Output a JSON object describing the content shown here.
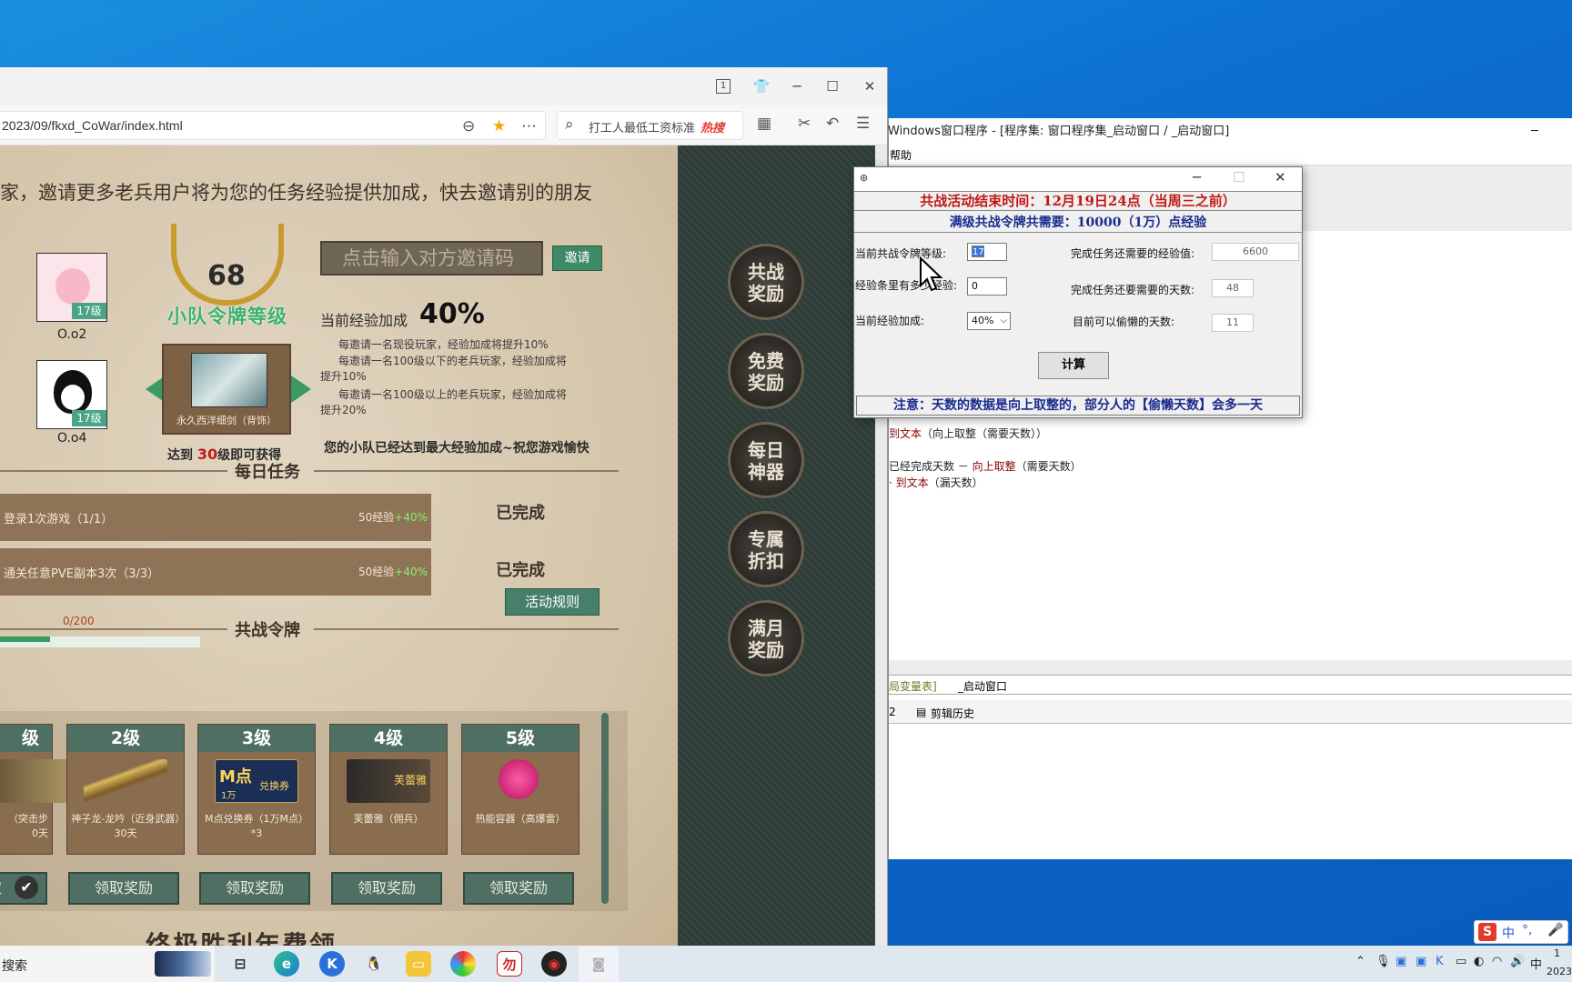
{
  "browser": {
    "url": "2023/09/fkxd_CoWar/index.html",
    "search_text": "打工人最低工资标准",
    "search_hot": "热搜",
    "tab_count": "1"
  },
  "game": {
    "invite_banner": "家，邀请更多老兵用户将为您的任务经验提供加成，快去邀请别的朋友",
    "friends": [
      {
        "name": "O.o2",
        "level": "17级"
      },
      {
        "name": "O.o4",
        "level": "17级"
      }
    ],
    "team_level_num": "68",
    "team_level_title": "小队令牌等级",
    "code_placeholder": "点击输入对方邀请码",
    "invite_btn": "邀请",
    "bonus_label": "当前经验加成",
    "bonus_value": "40%",
    "rules": [
      "每邀请一名现役玩家，经验加成将提升10%",
      "每邀请一名100级以下的老兵玩家，经验加成将",
      "提升10%",
      "每邀请一名100级以上的老兵玩家，经验加成将",
      "提升20%"
    ],
    "reward_name": "永久西洋细剑（背饰）",
    "reach_prefix": "达到",
    "reach_level": "30",
    "reach_suffix": "级即可获得",
    "maxed_text": "您的小队已经达到最大经验加成~祝您游戏愉快",
    "daily_title": "每日任务",
    "tasks": [
      {
        "name": "登录1次游戏（1/1）",
        "exp": "50经验",
        "bonus": "+40%",
        "status": "已完成"
      },
      {
        "name": "通关任意PVE副本3次（3/3）",
        "exp": "50经验",
        "bonus": "+40%",
        "status": "已完成"
      }
    ],
    "token_title": "共战令牌",
    "rules_btn": "活动规则",
    "progress_text": "0/200",
    "progress_fraction": 0.25,
    "tiers": [
      {
        "level": "级",
        "reward": "（突击步\n0天",
        "claim": "取"
      },
      {
        "level": "2级",
        "reward": "神子龙-龙吟（近身武器）30天",
        "claim": "领取奖励"
      },
      {
        "level": "3级",
        "reward": "M点兑换券（1万M点）*3",
        "claim": "领取奖励"
      },
      {
        "level": "4级",
        "reward": "芙蕾雅（佣兵）",
        "claim": "领取奖励"
      },
      {
        "level": "5级",
        "reward": "热能容器（高爆雷）",
        "claim": "领取奖励"
      }
    ],
    "voucher_text": "M点",
    "voucher_sub": "兑换券",
    "voucher_amt": "1万",
    "merc_name": "芙蕾雅",
    "side_buttons": [
      "共战\n奖励",
      "免费\n奖励",
      "每日\n神器",
      "专属\n折扣",
      "满月\n奖励"
    ],
    "bottom_text": "终极胜利年费领"
  },
  "ide": {
    "title": "Windows窗口程序 - [程序集: 窗口程序集_启动窗口 / _启动窗口]",
    "menu_item": "帮助",
    "code_lines": [
      {
        "pre": "",
        "kw": "到文本",
        "post": "（向上取整（需要天数））"
      },
      {
        "pre": "已经完成天数 － ",
        "kw": "向上取整",
        "post": "（需要天数）"
      },
      {
        "pre": "· ",
        "kw": "到文本",
        "post": "（漏天数）"
      }
    ],
    "tab1": "局变量表]",
    "tab2": "_启动窗口",
    "tab3": "2",
    "tab4": "剪辑历史",
    "minimize": "─"
  },
  "dialog": {
    "header1": "共战活动结束时间：12月19日24点（当周三之前）",
    "header2": "满级共战令牌共需要：10000（1万）点经验",
    "label_level": "当前共战令牌等级:",
    "val_level": "17",
    "label_bar": "经验条里有多少经验:",
    "val_bar": "0",
    "label_bonus": "当前经验加成:",
    "val_bonus": "40%",
    "label_need_exp": "完成任务还需要的经验值:",
    "val_need_exp": "6600",
    "label_need_days": "完成任务还要需要的天数:",
    "val_need_days": "48",
    "label_lazy": "目前可以偷懒的天数:",
    "val_lazy": "11",
    "calc_btn": "计算",
    "note": "注意：天数的数据是向上取整的，部分人的【偷懒天数】会多一天"
  },
  "taskbar": {
    "search": "搜索",
    "ime": "中",
    "time": "1",
    "date": "2023"
  }
}
